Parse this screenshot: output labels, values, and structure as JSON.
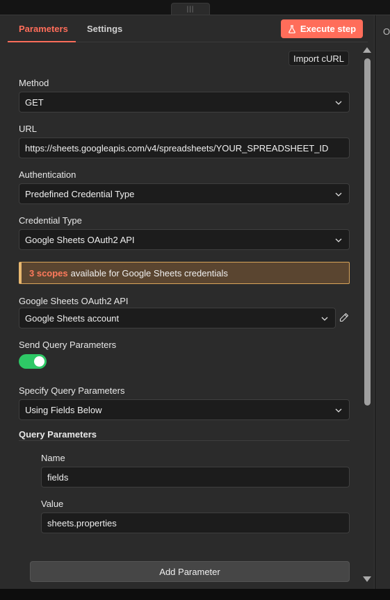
{
  "tabs": {
    "parameters": "Parameters",
    "settings": "Settings"
  },
  "execute_label": "Execute step",
  "import_label": "Import cURL",
  "right_strip_text": "O",
  "method": {
    "label": "Method",
    "value": "GET"
  },
  "url": {
    "label": "URL",
    "value": "https://sheets.googleapis.com/v4/spreadsheets/YOUR_SPREADSHEET_ID"
  },
  "authentication": {
    "label": "Authentication",
    "value": "Predefined Credential Type"
  },
  "credential_type": {
    "label": "Credential Type",
    "value": "Google Sheets OAuth2 API"
  },
  "notice": {
    "highlight": "3 scopes",
    "text": "available for Google Sheets credentials"
  },
  "oauth": {
    "label": "Google Sheets OAuth2 API",
    "value": "Google Sheets account"
  },
  "send_query": {
    "label": "Send Query Parameters",
    "enabled": true
  },
  "specify_query": {
    "label": "Specify Query Parameters",
    "value": "Using Fields Below"
  },
  "query_parameters": {
    "label": "Query Parameters",
    "name_label": "Name",
    "name_value": "fields",
    "value_label": "Value",
    "value_value": "sheets.properties",
    "add_label": "Add Parameter"
  },
  "colors": {
    "accent": "#ff6d5a",
    "toggle_on": "#2ec866",
    "notice_bg": "#5a4530",
    "notice_border": "#d9a55a"
  }
}
